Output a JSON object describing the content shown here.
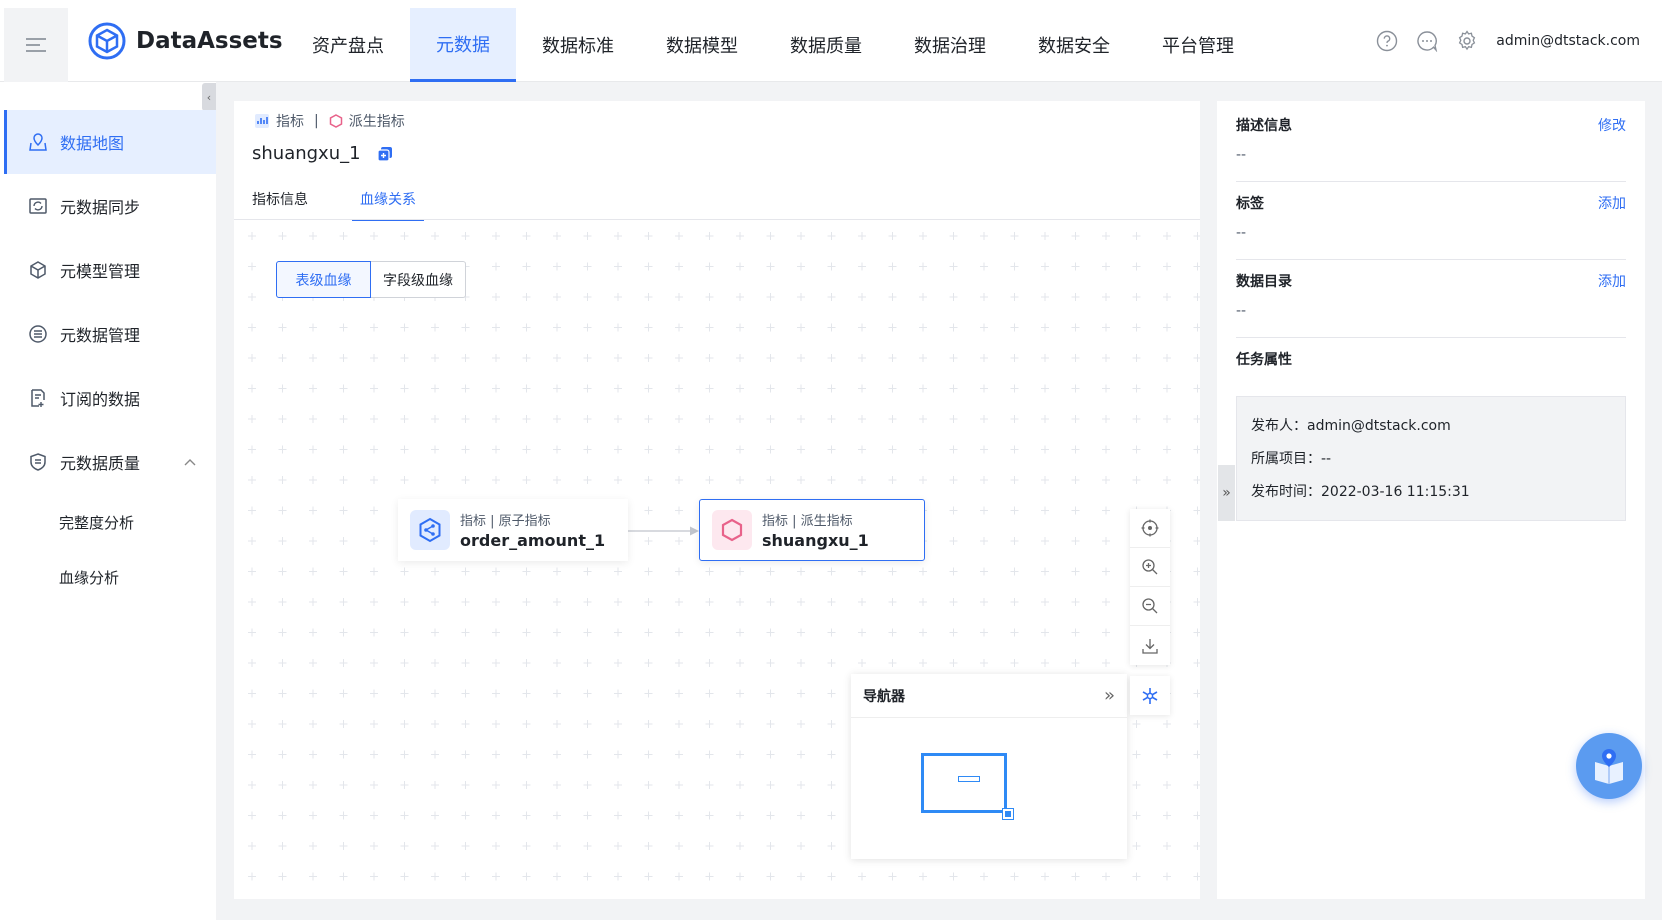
{
  "app": {
    "name": "DataAssets"
  },
  "nav": [
    {
      "label": "资产盘点"
    },
    {
      "label": "元数据",
      "active": true
    },
    {
      "label": "数据标准"
    },
    {
      "label": "数据模型"
    },
    {
      "label": "数据质量"
    },
    {
      "label": "数据治理"
    },
    {
      "label": "数据安全"
    },
    {
      "label": "平台管理"
    }
  ],
  "header": {
    "user": "admin@dtstack.com",
    "icons": [
      "help-icon",
      "message-icon",
      "settings-icon"
    ]
  },
  "sidebar": {
    "collapse_glyph": "‹",
    "items": [
      {
        "label": "数据地图",
        "icon": "data-map-icon",
        "active": true
      },
      {
        "label": "元数据同步",
        "icon": "sync-icon"
      },
      {
        "label": "元模型管理",
        "icon": "cube-icon"
      },
      {
        "label": "元数据管理",
        "icon": "database-icon"
      },
      {
        "label": "订阅的数据",
        "icon": "subscribe-icon"
      },
      {
        "label": "元数据质量",
        "icon": "quality-icon",
        "expanded": true
      }
    ],
    "sub_items": [
      {
        "label": "完整度分析"
      },
      {
        "label": "血缘分析"
      }
    ]
  },
  "main": {
    "breadcrumb": {
      "type": "指标",
      "separator": "|",
      "subtype": "派生指标"
    },
    "title": "shuangxu_1",
    "tabs": [
      {
        "label": "指标信息"
      },
      {
        "label": "血缘关系",
        "active": true
      }
    ],
    "lineage_mode": [
      {
        "label": "表级血缘",
        "active": true
      },
      {
        "label": "字段级血缘"
      }
    ],
    "nodes": [
      {
        "meta": "指标 | 原子指标",
        "name": "order_amount_1",
        "icon": "share-icon"
      },
      {
        "meta": "指标 | 派生指标",
        "name": "shuangxu_1",
        "icon": "hexagon-icon"
      }
    ],
    "navigator": {
      "title": "导航器",
      "collapse_glyph": "»"
    }
  },
  "right_panel": {
    "toggle_glyph": "»",
    "sections": [
      {
        "title": "描述信息",
        "action": "修改",
        "value": "--"
      },
      {
        "title": "标签",
        "action": "添加",
        "value": "--"
      },
      {
        "title": "数据目录",
        "action": "添加",
        "value": "--"
      }
    ],
    "task": {
      "title": "任务属性",
      "publisher": "发布人：admin@dtstack.com",
      "project": "所属项目：--",
      "publish_time": "发布时间：2022-03-16 11:15:31"
    }
  },
  "colors": {
    "accent": "#2f6ef3",
    "pink": "#e8628a"
  }
}
